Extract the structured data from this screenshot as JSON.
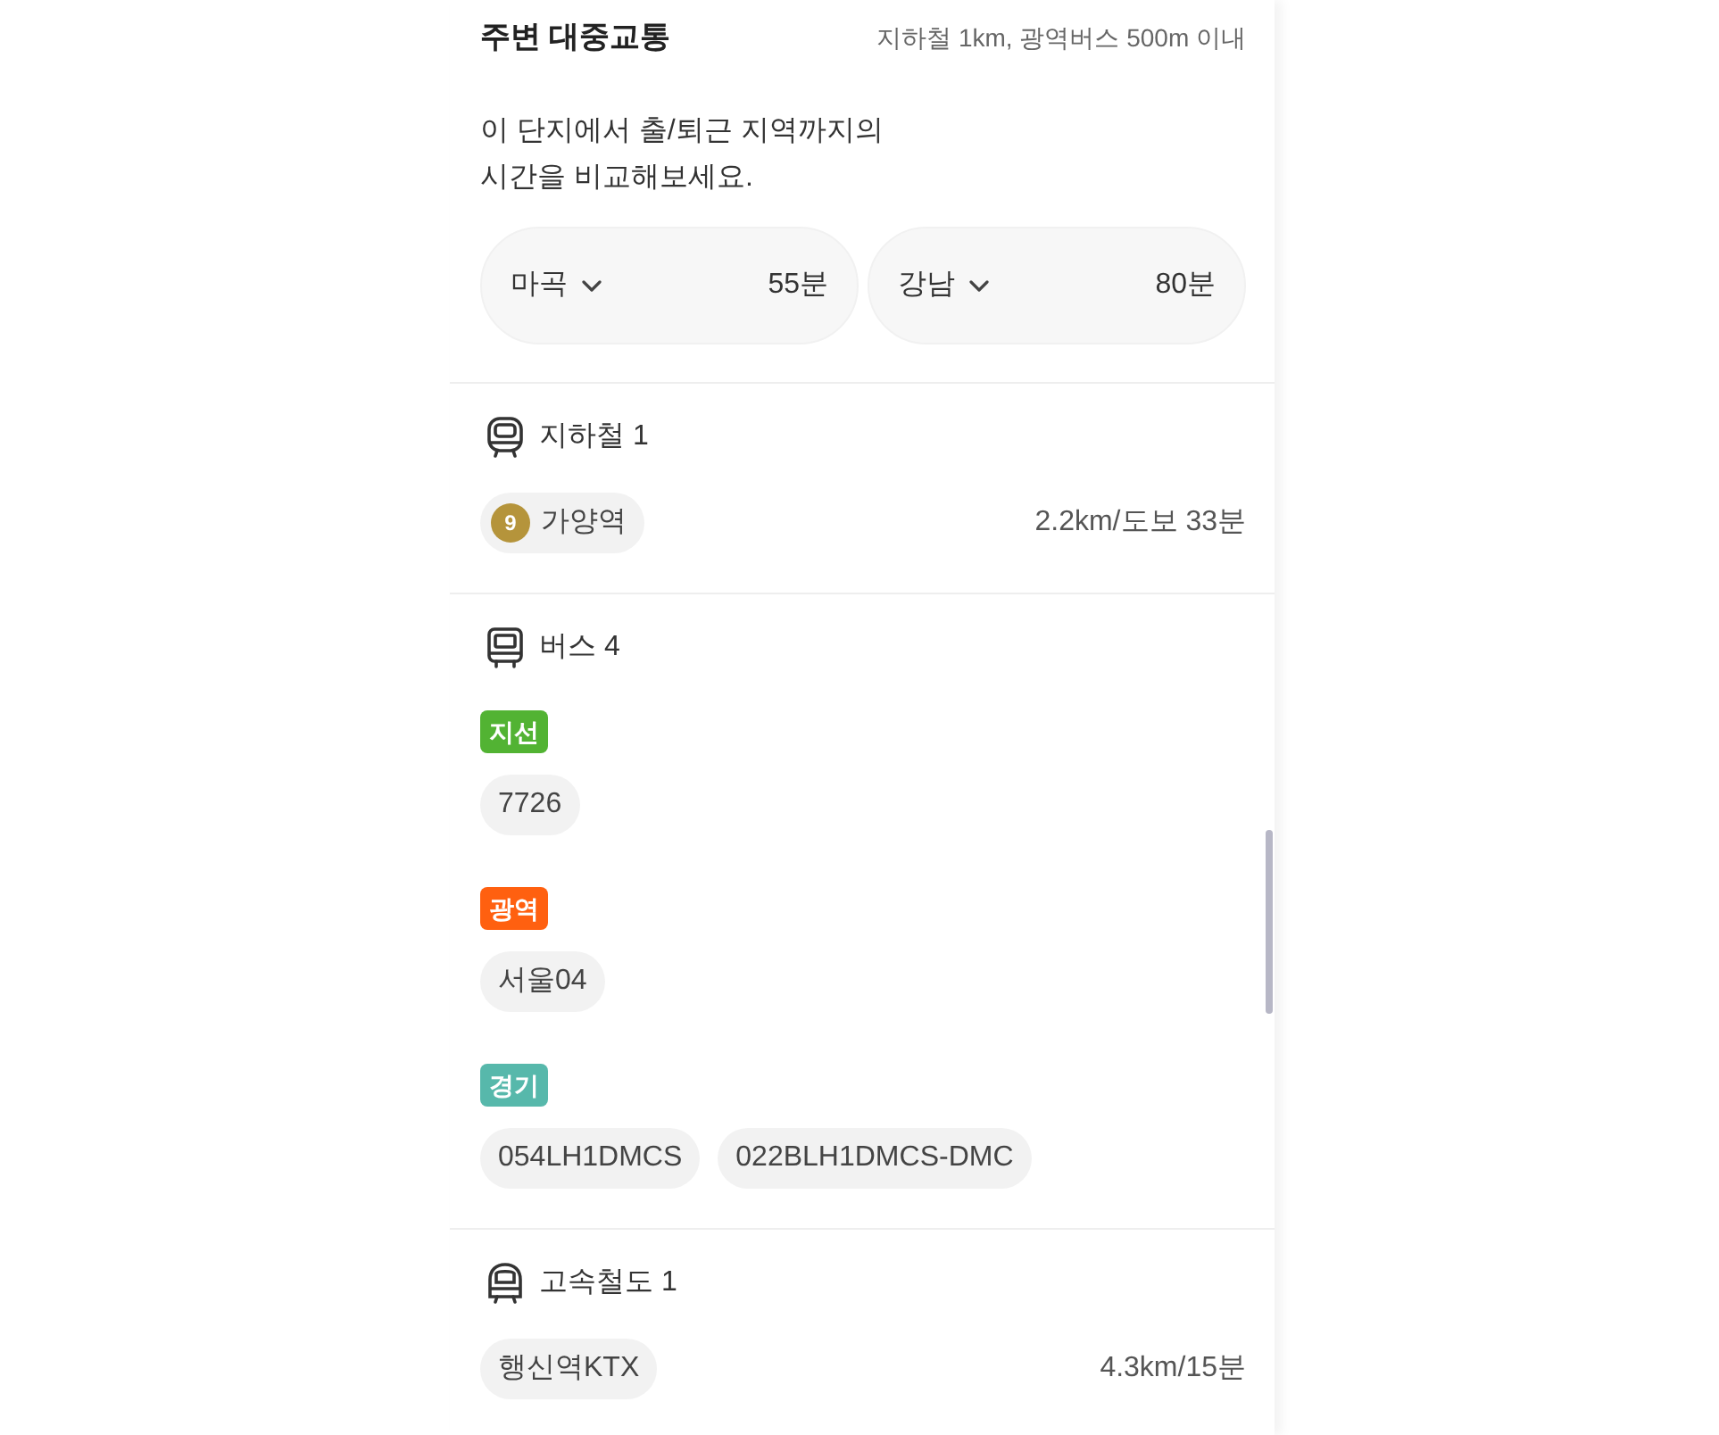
{
  "header": {
    "title": "주변 대중교통",
    "note": "지하철 1km, 광역버스 500m 이내"
  },
  "commute": {
    "description": "이 단지에서 출/퇴근 지역까지의\n시간을 비교해보세요.",
    "destinations": [
      {
        "name": "마곡",
        "time": "55분"
      },
      {
        "name": "강남",
        "time": "80분"
      }
    ]
  },
  "sections": [
    {
      "kind": "subway",
      "title": "지하철 1",
      "items": [
        {
          "line": "9",
          "color": "#b5943b",
          "name": "가양역",
          "distance": "2.2km/도보 33분"
        }
      ]
    },
    {
      "kind": "bus",
      "title": "버스 4",
      "groups": [
        {
          "label": "지선",
          "color": "#52b333",
          "routes": [
            "7726"
          ]
        },
        {
          "label": "광역",
          "color": "#ff6010",
          "routes": [
            "서울04"
          ]
        },
        {
          "label": "경기",
          "color": "#57b8ab",
          "routes": [
            "054LH1DMCS",
            "022BLH1DMCS-DMC"
          ]
        }
      ]
    },
    {
      "kind": "rail",
      "title": "고속철도 1",
      "items": [
        {
          "name": "행신역KTX",
          "distance": "4.3km/15분"
        }
      ]
    }
  ]
}
